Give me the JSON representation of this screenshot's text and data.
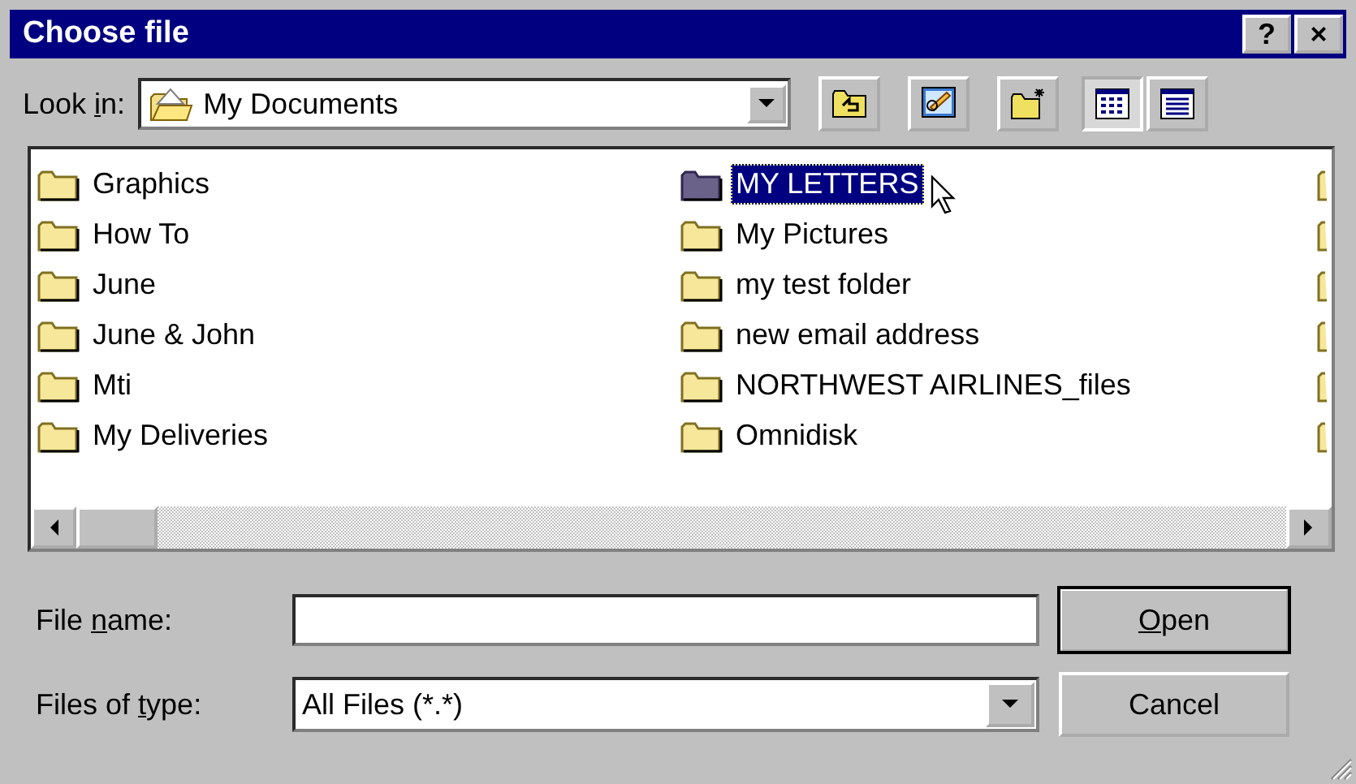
{
  "window": {
    "title": "Choose file",
    "title_buttons": [
      "?",
      "×"
    ]
  },
  "look_in": {
    "label_parts": [
      {
        "text": "Look "
      },
      {
        "text": "i",
        "underline": true
      },
      {
        "text": "n:"
      }
    ],
    "value": "My Documents"
  },
  "toolbar": [
    {
      "kind": "up-folder",
      "selected": false
    },
    {
      "kind": "desktop",
      "selected": false
    },
    {
      "kind": "new-folder",
      "selected": false
    },
    {
      "kind": "list-view",
      "selected": true
    },
    {
      "kind": "details-view",
      "selected": false
    }
  ],
  "file_list": {
    "columns": [
      [
        {
          "kind": "folder",
          "name": "Graphics",
          "selected": false
        },
        {
          "kind": "folder",
          "name": "How To",
          "selected": false
        },
        {
          "kind": "folder",
          "name": "June",
          "selected": false
        },
        {
          "kind": "folder",
          "name": "June & John",
          "selected": false
        },
        {
          "kind": "folder",
          "name": "Mti",
          "selected": false
        },
        {
          "kind": "folder",
          "name": "My Deliveries",
          "selected": false
        }
      ],
      [
        {
          "kind": "folder",
          "name": "MY LETTERS",
          "selected": true
        },
        {
          "kind": "folder",
          "name": "My Pictures",
          "selected": false
        },
        {
          "kind": "folder",
          "name": "my test folder",
          "selected": false
        },
        {
          "kind": "folder",
          "name": "new email address",
          "selected": false
        },
        {
          "kind": "folder",
          "name": "NORTHWEST AIRLINES_files",
          "selected": false
        },
        {
          "kind": "folder",
          "name": "Omnidisk",
          "selected": false
        }
      ],
      [
        {
          "kind": "clipped-folder"
        },
        {
          "kind": "clipped-folder"
        },
        {
          "kind": "clipped-folder"
        },
        {
          "kind": "clipped-folder"
        },
        {
          "kind": "clipped-folder"
        },
        {
          "kind": "clipped-folder"
        }
      ]
    ]
  },
  "file_name": {
    "label_parts": [
      {
        "text": "File "
      },
      {
        "text": "n",
        "underline": true
      },
      {
        "text": "ame:"
      }
    ]
  },
  "file_type": {
    "label_parts": [
      {
        "text": "Files of "
      },
      {
        "text": "t",
        "underline": true
      },
      {
        "text": "ype:"
      }
    ],
    "value": "All Files (*.*)"
  },
  "buttons": [
    {
      "label_parts": [
        {
          "text": "O",
          "underline": true
        },
        {
          "text": "pen"
        }
      ],
      "default": true
    },
    {
      "label_parts": [
        {
          "text": "Cancel"
        }
      ],
      "default": false
    }
  ]
}
